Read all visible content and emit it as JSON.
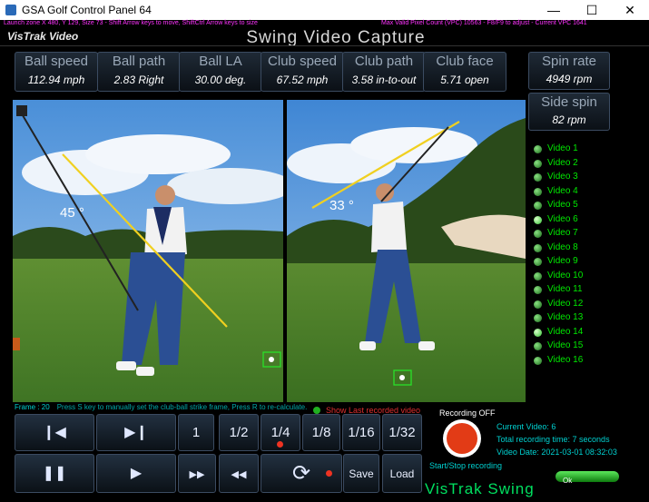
{
  "window": {
    "title": "GSA Golf Control Panel 64",
    "controls": [
      "—",
      "☐",
      "✕"
    ]
  },
  "infobar": {
    "left": "Launch zone  X 480, Y 129, Size 73 - Shift Arrow keys to move, ShiftCtrl Arrow keys to size",
    "right": "Max Valid Pixel Count (VPC)  10563  -  F8/F9 to adjust  -  Current VPC   1641"
  },
  "header": {
    "brand": "VisTrak Video",
    "title": "Swing Video Capture"
  },
  "stats": [
    {
      "label": "Ball speed",
      "value": "112.94 mph"
    },
    {
      "label": "Ball path",
      "value": "2.83 Right"
    },
    {
      "label": "Ball LA",
      "value": "30.00 deg."
    },
    {
      "label": "Club speed",
      "value": "67.52 mph"
    },
    {
      "label": "Club path",
      "value": "3.58 in-to-out"
    },
    {
      "label": "Club face",
      "value": "5.71 open"
    }
  ],
  "spin": [
    {
      "label": "Spin rate",
      "value": "4949 rpm"
    },
    {
      "label": "Side spin",
      "value": "82 rpm"
    }
  ],
  "videos": {
    "left_angle": "45 °",
    "right_angle": "33 °"
  },
  "video_list": [
    {
      "label": "Video 1",
      "active": false
    },
    {
      "label": "Video 2",
      "active": false
    },
    {
      "label": "Video 3",
      "active": false
    },
    {
      "label": "Video 4",
      "active": false
    },
    {
      "label": "Video 5",
      "active": false
    },
    {
      "label": "Video 6",
      "active": true
    },
    {
      "label": "Video 7",
      "active": false
    },
    {
      "label": "Video 8",
      "active": false
    },
    {
      "label": "Video 9",
      "active": false
    },
    {
      "label": "Video 10",
      "active": false
    },
    {
      "label": "Video 11",
      "active": false
    },
    {
      "label": "Video 12",
      "active": false
    },
    {
      "label": "Video 13",
      "active": false
    },
    {
      "label": "Video 14",
      "active": true
    },
    {
      "label": "Video 15",
      "active": false
    },
    {
      "label": "Video 16",
      "active": false
    }
  ],
  "frame": {
    "label": "Frame : 20",
    "hint": "Press S key to manually set the club-ball strike frame, Press R to re-calculate.",
    "show_last": "Show Last recorded video"
  },
  "playback": {
    "prev": "❙◀",
    "next": "▶❙",
    "speeds": [
      "1",
      "1/2",
      "1/4",
      "1/8",
      "1/16",
      "1/32"
    ],
    "pause": "❚❚",
    "play": "▶",
    "fast_forward": "▶▶",
    "rewind": "◀◀",
    "loop": "⟳",
    "save": "Save",
    "load": "Load"
  },
  "recording": {
    "status": "Recording OFF",
    "caption": "Start/Stop recording",
    "current_video": "Current Video: 6",
    "total_time": "Total recording time: 7 seconds",
    "video_date": "Video Date: 2021-03-01 08:32:03"
  },
  "footer": {
    "brand": "VisTrak Swing",
    "ok": "Ok"
  }
}
